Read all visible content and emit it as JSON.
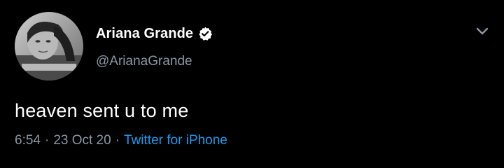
{
  "tweet": {
    "author": {
      "display_name": "Ariana Grande",
      "handle": "@ArianaGrande",
      "verified": true,
      "avatar_icon": "avatar-photo"
    },
    "text": "heaven sent u to me",
    "meta": {
      "time": "6:54",
      "separator": "·",
      "date": "23 Oct 20",
      "source": "Twitter for iPhone"
    },
    "menu_icon": "chevron-down-icon"
  },
  "colors": {
    "background": "#000000",
    "primary_text": "#ffffff",
    "secondary_text": "#8b98a5",
    "link": "#1d9bf0"
  }
}
